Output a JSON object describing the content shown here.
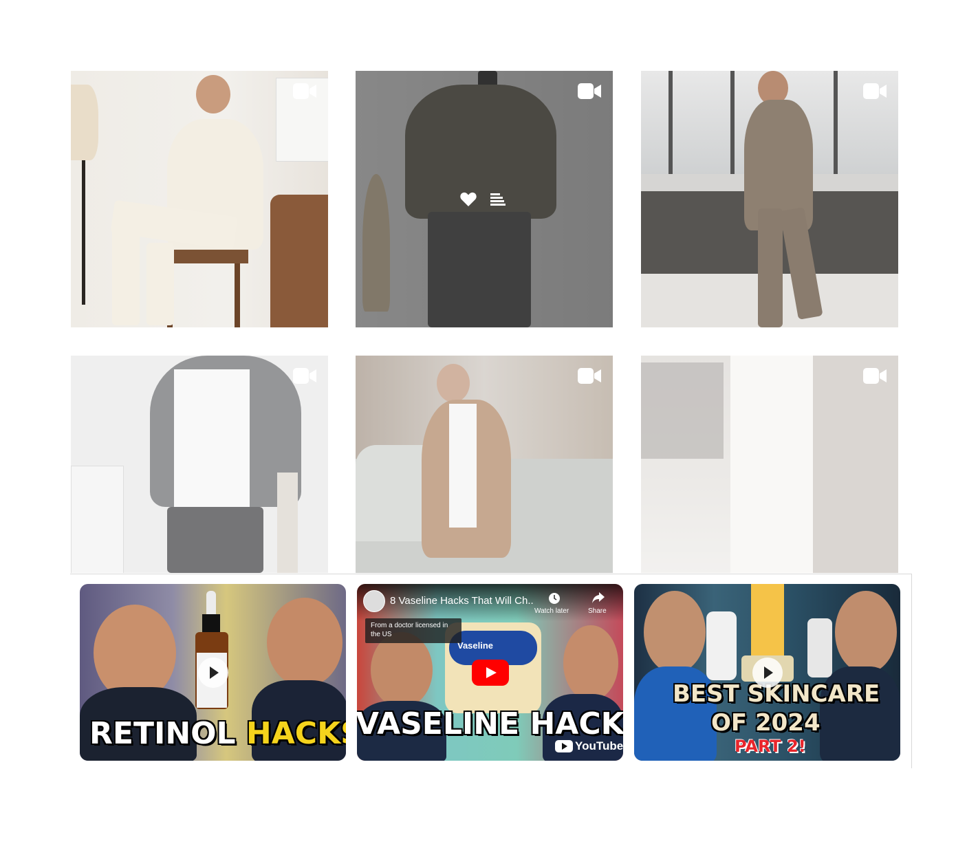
{
  "feed": {
    "tiles": [
      {
        "type": "video",
        "icon": "video-camera-icon"
      },
      {
        "type": "video",
        "icon": "video-camera-icon",
        "hovered": true,
        "hover_icons": [
          "heart-icon",
          "comments-icon"
        ]
      },
      {
        "type": "video",
        "icon": "video-camera-icon"
      },
      {
        "type": "video",
        "icon": "video-camera-icon"
      },
      {
        "type": "video",
        "icon": "video-camera-icon"
      },
      {
        "type": "video",
        "icon": "video-camera-icon"
      }
    ]
  },
  "youtube": {
    "videos": [
      {
        "caption_white": "RETINOL",
        "caption_yellow": "HACKS",
        "play_icon": "play-icon"
      },
      {
        "title": "8 Vaseline Hacks That Will Ch...",
        "watch_later": "Watch later",
        "share": "Share",
        "badge_text": "From a doctor licensed in the US",
        "caption": "VASELINE HACKS",
        "brand": "Vaseline",
        "youtube_label": "YouTube",
        "play_icon": "youtube-play-icon"
      },
      {
        "caption_line1": "BEST SKINCARE",
        "caption_line2": "OF 2024",
        "caption_line3": "PART 2!",
        "play_icon": "play-icon"
      }
    ]
  },
  "colors": {
    "caption_yellow": "#f5d31c",
    "caption_red": "#e8252b",
    "youtube_red": "#ff0000"
  }
}
